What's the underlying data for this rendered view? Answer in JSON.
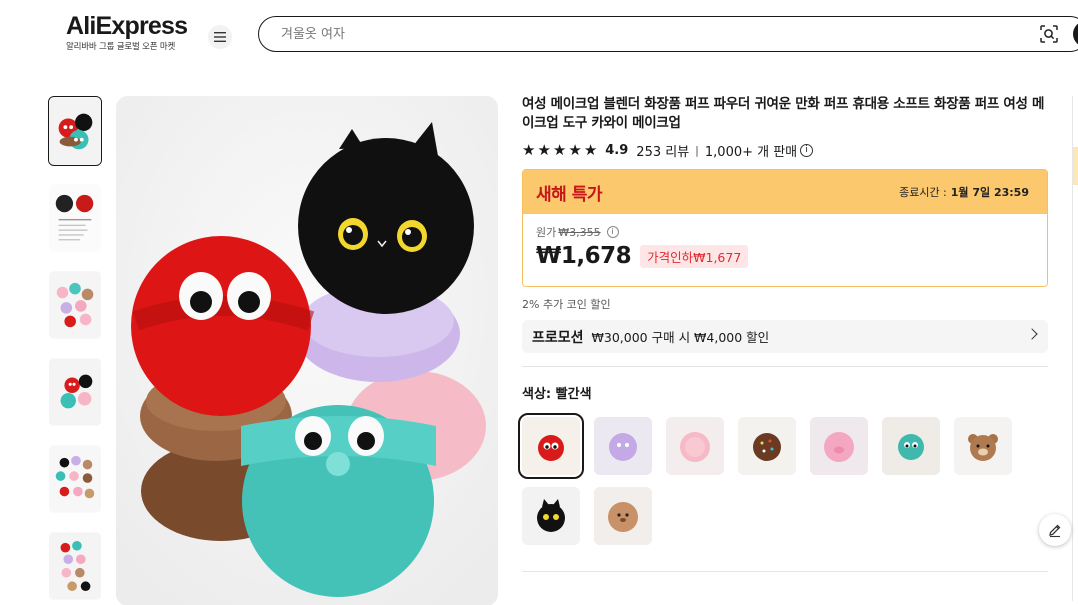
{
  "header": {
    "logo_text": "AliExpress",
    "logo_subtitle": "알리바바 그룹 글로벌 오픈 마켓",
    "search_placeholder": "겨울옷 여자"
  },
  "product": {
    "title": "여성 메이크업 블렌더 화장품 퍼프 파우더 귀여운 만화 퍼프 휴대용 소프트 화장품 퍼프 여성 메이크업 도구 카와이 메이크업",
    "rating": "4.9",
    "reviews": "253 리뷰",
    "sold": "1,000+ 개 판매",
    "rating_stars": 5
  },
  "deal": {
    "name": "새해 특가",
    "end_label": "종료시간 :",
    "end_time": "1월 7일 23:59",
    "original_label": "원가",
    "original_price": "₩3,355",
    "price": "₩1,678",
    "price_drop": "가격인하₩1,677",
    "coin_discount": "2% 추가 코인 할인"
  },
  "promotion": {
    "tag": "프로모션",
    "text": "₩30,000 구매 시 ₩4,000 할인"
  },
  "color": {
    "label": "색상: 빨간색",
    "options": [
      "red",
      "purple",
      "pink",
      "donut",
      "pink-pig",
      "teal",
      "bear",
      "black-cat",
      "brown"
    ]
  },
  "colors": {
    "accent_red": "#c7161a",
    "deal_yellow": "#fcc86d",
    "drop_text": "#e52a31"
  }
}
